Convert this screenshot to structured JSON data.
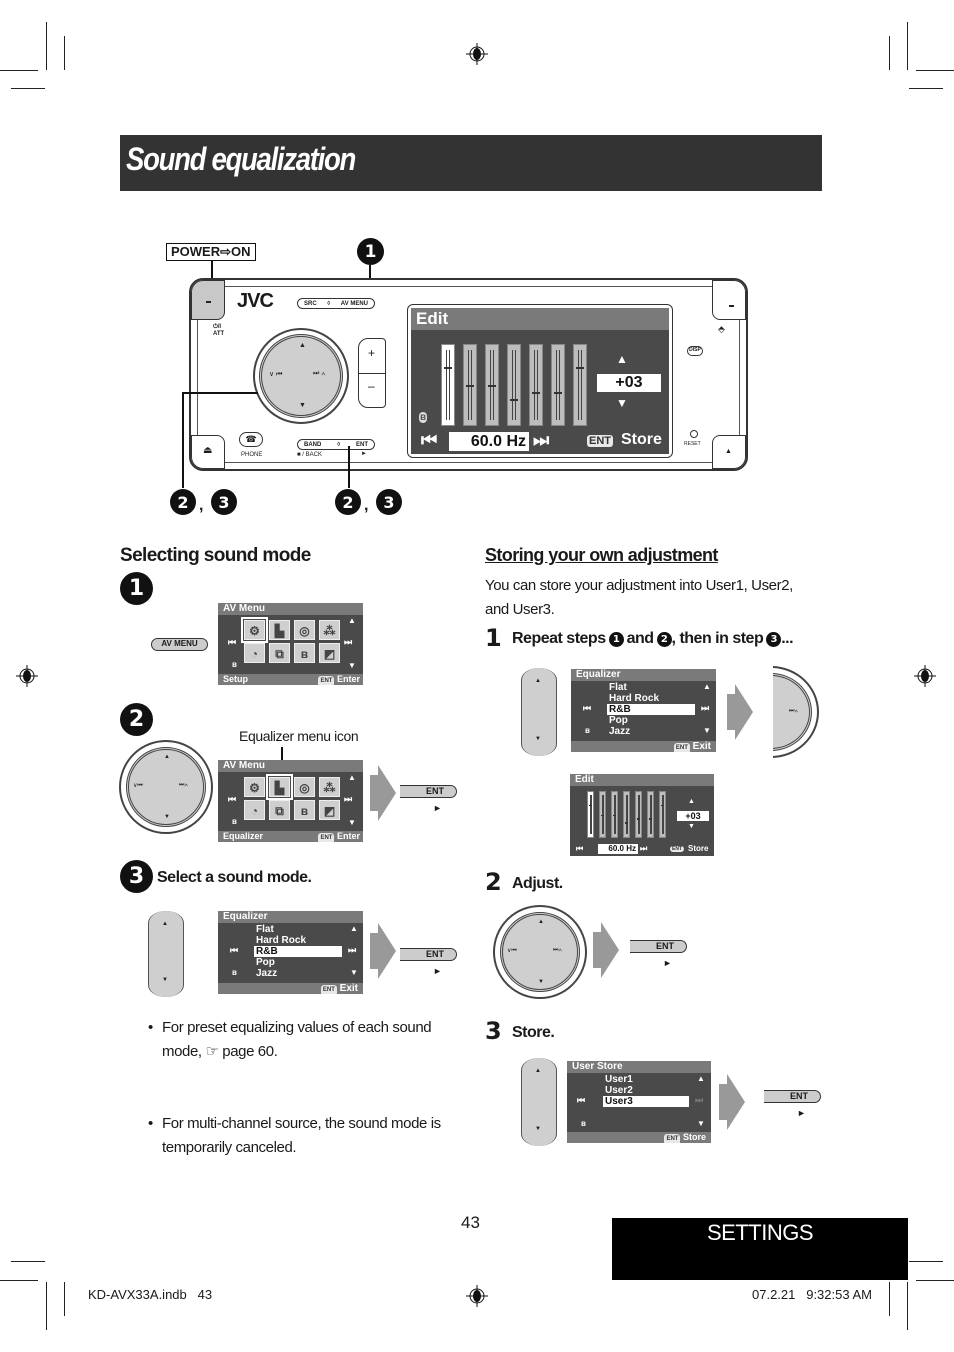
{
  "page": {
    "title": "Sound equalization",
    "page_number": "43",
    "section_tab": "SETTINGS",
    "footer_left": "KD-AVX33A.indb   43",
    "footer_right": "07.2.21   9:32:53 AM"
  },
  "unit_diagram": {
    "power_label": "POWER⇨ON",
    "callout_1": "1",
    "callout_23_left": [
      "2",
      "3"
    ],
    "callout_23_right": [
      "2",
      "3"
    ],
    "brand": "JVC",
    "buttons": {
      "src": "SRC",
      "av_menu": "AV MENU",
      "band": "BAND",
      "ent": "ENT",
      "stop_back": "■ / BACK",
      "play": "►",
      "phone": "PHONE",
      "att": "⏻/I ATT",
      "disp": "DISP",
      "reset": "RESET",
      "plus": "+",
      "minus": "–",
      "eject": "⏏"
    },
    "dial_labels": {
      "left": "∨ ⏮",
      "right": "⏭ ∧"
    },
    "screen": {
      "header": "Edit",
      "value": "+03",
      "frequency": "60.0 Hz",
      "ent": "ENT",
      "store": "Store",
      "bands_level": [
        0.75,
        0.5,
        0.5,
        0.3,
        0.4,
        0.4,
        0.75
      ],
      "active_band": 0
    }
  },
  "left_section": {
    "heading": "Selecting sound mode",
    "step1": {
      "num": "1",
      "key_label": "AV MENU",
      "screen": {
        "header": "AV Menu",
        "footer_left": "Setup",
        "ent": "ENT",
        "footer_right": "Enter",
        "focused_tile": 0
      }
    },
    "step2": {
      "num": "2",
      "callout": "Equalizer menu icon",
      "screen": {
        "header": "AV Menu",
        "footer_left": "Equalizer",
        "ent": "ENT",
        "footer_right": "Enter",
        "focused_tile": 1
      },
      "ent_key": "ENT",
      "play": "►"
    },
    "step3": {
      "num": "3",
      "label": "Select a sound mode.",
      "screen": {
        "header": "Equalizer",
        "items": [
          "Flat",
          "Hard Rock",
          "R&B",
          "Pop",
          "Jazz"
        ],
        "selected": "R&B",
        "ent": "ENT",
        "footer_right": "Exit"
      },
      "ent_key": "ENT",
      "play": "►"
    },
    "notes": [
      "For preset equalizing values of each sound mode, ☞ page 60.",
      "For multi-channel source, the sound mode is temporarily canceled."
    ]
  },
  "right_section": {
    "heading": "Storing your own adjustment",
    "intro": "You can store your adjustment into User1, User2, and User3.",
    "step1": {
      "num": "1",
      "label_parts": [
        "Repeat steps",
        "1",
        "and",
        "2",
        ", then in step",
        "3",
        "..."
      ],
      "eq_screen": {
        "header": "Equalizer",
        "items": [
          "Flat",
          "Hard Rock",
          "R&B",
          "Pop",
          "Jazz"
        ],
        "selected": "R&B",
        "ent": "ENT",
        "footer_right": "Exit"
      },
      "edit_screen": {
        "header": "Edit",
        "value": "+03",
        "frequency": "60.0 Hz",
        "ent": "ENT",
        "store": "Store",
        "bands_level": [
          0.75,
          0.5,
          0.5,
          0.3,
          0.4,
          0.4,
          0.75
        ]
      }
    },
    "step2": {
      "num": "2",
      "label": "Adjust.",
      "ent_key": "ENT",
      "play": "►"
    },
    "step3": {
      "num": "3",
      "label": "Store.",
      "screen": {
        "header": "User Store",
        "items": [
          "User1",
          "User2",
          "User3"
        ],
        "selected": "User3",
        "ent": "ENT",
        "footer_right": "Store"
      },
      "ent_key": "ENT",
      "play": "►"
    }
  }
}
